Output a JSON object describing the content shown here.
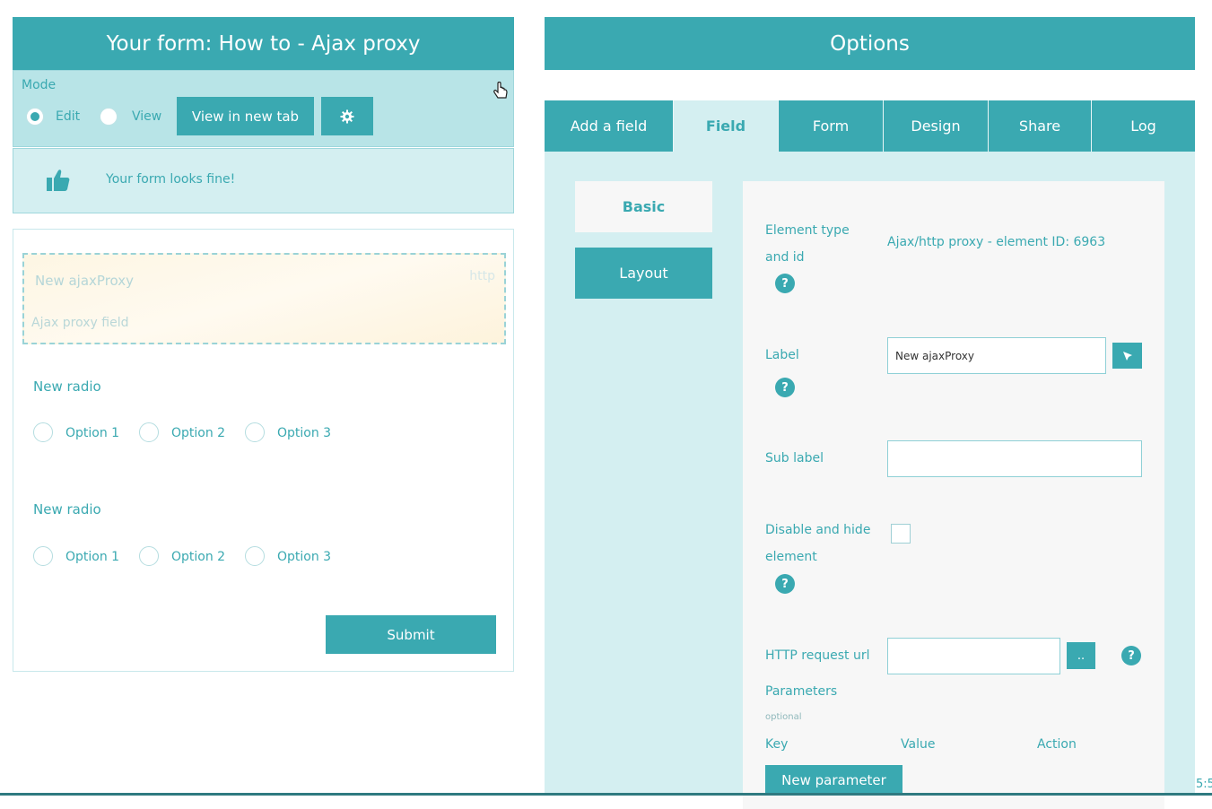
{
  "form_panel": {
    "title": "Your form: How to - Ajax proxy",
    "mode_label": "Mode",
    "modes": [
      "Edit",
      "View"
    ],
    "selected_mode": "Edit",
    "view_new_tab_label": "View in new tab",
    "settings_icon": "gear-icon",
    "status_icon": "thumbs-up-icon",
    "status_text": "Your form looks fine!",
    "proxy_field": {
      "label": "New ajaxProxy",
      "type_hint": "http",
      "sub_label": "Ajax proxy field"
    },
    "radio_groups": [
      {
        "title": "New radio",
        "options": [
          "Option 1",
          "Option 2",
          "Option 3"
        ]
      },
      {
        "title": "New radio",
        "options": [
          "Option 1",
          "Option 2",
          "Option 3"
        ]
      }
    ],
    "submit_label": "Submit"
  },
  "options_panel": {
    "title": "Options",
    "tabs": [
      "Add a field",
      "Field",
      "Form",
      "Design",
      "Share",
      "Log"
    ],
    "active_tab": "Field",
    "sub_tabs": [
      "Basic",
      "Layout"
    ],
    "active_sub_tab": "Basic",
    "props": {
      "element_type_label": "Element type and id",
      "element_type_value": "Ajax/http proxy - element ID: 6963",
      "label_label": "Label",
      "label_value": "New ajaxProxy",
      "sub_label_label": "Sub label",
      "sub_label_value": "",
      "disable_label": "Disable and hide element",
      "disable_checked": false,
      "http_url_label": "HTTP request url",
      "http_url_value": "",
      "browse_label": "..",
      "params_label": "Parameters",
      "params_optional": "optional",
      "col_key": "Key",
      "col_value": "Value",
      "col_action": "Action",
      "new_param_label": "New parameter",
      "help_glyph": "?"
    }
  },
  "clock_fragment": "5:5",
  "colors": {
    "accent": "#3aa9b1",
    "panel_light": "#d4eff1",
    "mode_bar": "#b8e4e7"
  }
}
